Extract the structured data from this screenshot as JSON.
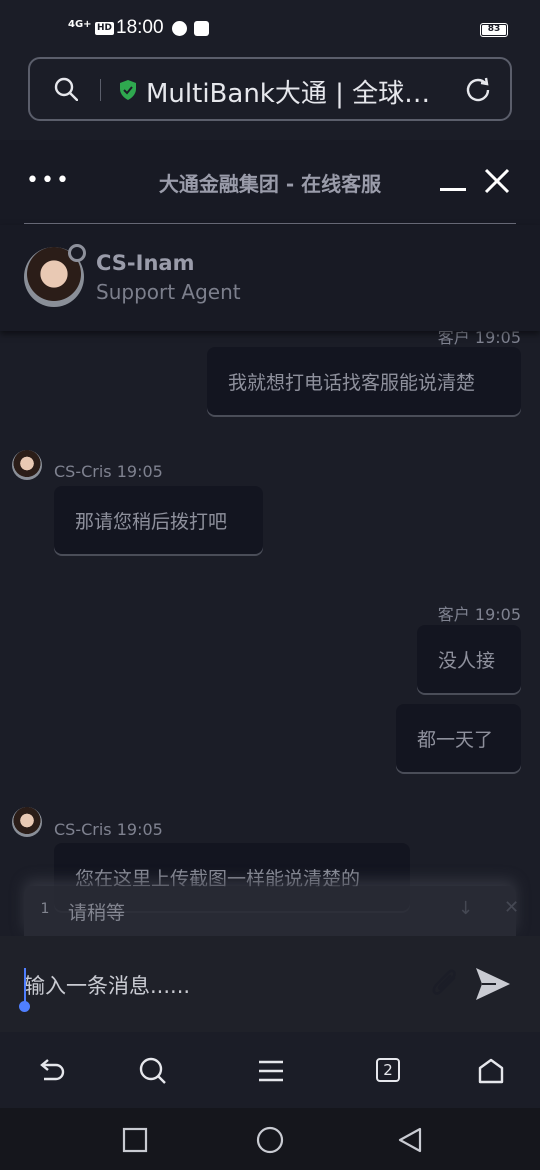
{
  "status_bar": {
    "network": "4G+",
    "hd": "HD",
    "time": "18:00",
    "battery": "83"
  },
  "url_bar": {
    "text": "MultiBank大通 | 全球…"
  },
  "chat_header": {
    "title": "大通金融集团 - 在线客服"
  },
  "agent": {
    "name": "CS-Inam",
    "role": "Support Agent"
  },
  "messages": [
    {
      "meta": "客户 19:05",
      "text": "我就想打电话找客服能说清楚",
      "side": "right"
    },
    {
      "meta": "CS-Cris 19:05",
      "text": "那请您稍后拨打吧",
      "side": "left"
    },
    {
      "meta": "客户 19:05",
      "texts": [
        "没人接",
        "都一天了"
      ],
      "side": "right"
    },
    {
      "meta": "CS-Cris 19:05",
      "text": "您在这里上传截图一样能说清楚的",
      "side": "left"
    }
  ],
  "queue": {
    "number": "1",
    "text": "请稍等"
  },
  "composer": {
    "placeholder": "输入一条消息......"
  },
  "toolbar": {
    "tab_count": "2"
  },
  "colors": {
    "background": "#1b1d27",
    "accent": "#4f7fff",
    "bubble": "#131520"
  }
}
